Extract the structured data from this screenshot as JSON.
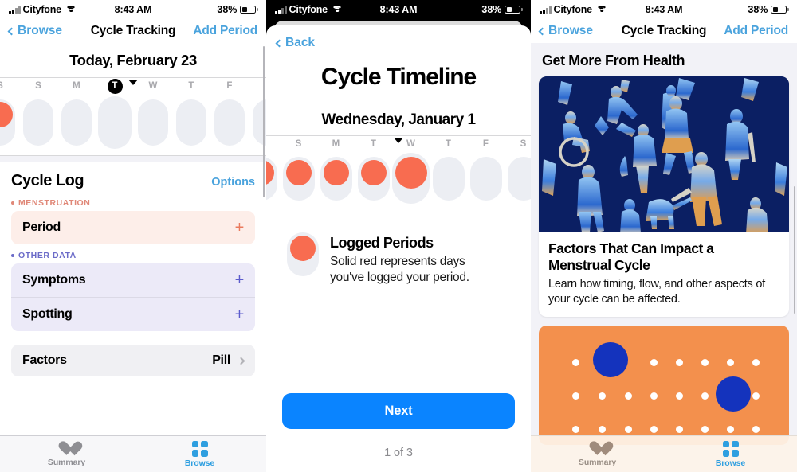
{
  "status_bar": {
    "carrier": "Cityfone",
    "time": "8:43 AM",
    "battery": "38%"
  },
  "colors": {
    "accent_blue": "#4aa3dd",
    "button_blue": "#0a84ff",
    "period_red": "#f86c50",
    "menstruation_label": "#e08878",
    "other_data_label": "#6b6bc8",
    "orange_card": "#f3904d",
    "artwork_navy": "#0b1f63",
    "blue_dot": "#1433bd"
  },
  "screen1": {
    "nav": {
      "back": "Browse",
      "title": "Cycle Tracking",
      "action": "Add Period"
    },
    "today_heading": "Today, February 23",
    "calendar": {
      "days": [
        {
          "letter": "S",
          "state": "period-partial",
          "today": false
        },
        {
          "letter": "S",
          "state": "empty",
          "today": false
        },
        {
          "letter": "M",
          "state": "empty",
          "today": false
        },
        {
          "letter": "T",
          "state": "selected",
          "today": true
        },
        {
          "letter": "W",
          "state": "empty",
          "today": false
        },
        {
          "letter": "T",
          "state": "empty",
          "today": false
        },
        {
          "letter": "F",
          "state": "empty",
          "today": false
        }
      ]
    },
    "cycle_log": {
      "title": "Cycle Log",
      "options_label": "Options",
      "groups": [
        {
          "label": "MENSTRUATION",
          "style": "mens",
          "rows": [
            {
              "label": "Period",
              "action": "+"
            }
          ]
        },
        {
          "label": "OTHER DATA",
          "style": "other",
          "rows": [
            {
              "label": "Symptoms",
              "action": "+"
            },
            {
              "label": "Spotting",
              "action": "+"
            }
          ]
        }
      ],
      "factors": {
        "label": "Factors",
        "value": "Pill"
      }
    },
    "tabbar": [
      {
        "label": "Summary",
        "icon": "heart-icon",
        "active": false
      },
      {
        "label": "Browse",
        "icon": "grid-icon",
        "active": true
      }
    ]
  },
  "screen2": {
    "back_label": "Back",
    "sheet_title": "Cycle Timeline",
    "date_heading": "Wednesday, January 1",
    "calendar": {
      "days": [
        {
          "letter": "",
          "state": "period-partial",
          "selected": false
        },
        {
          "letter": "S",
          "state": "period",
          "selected": false
        },
        {
          "letter": "M",
          "state": "period",
          "selected": false
        },
        {
          "letter": "T",
          "state": "period",
          "selected": false
        },
        {
          "letter": "W",
          "state": "period",
          "selected": true
        },
        {
          "letter": "T",
          "state": "empty",
          "selected": false
        },
        {
          "letter": "F",
          "state": "empty",
          "selected": false
        },
        {
          "letter": "S",
          "state": "empty",
          "selected": false
        }
      ]
    },
    "legend": {
      "heading": "Logged Periods",
      "body": "Solid red represents days you've logged your period."
    },
    "next_label": "Next",
    "page_indicator": "1 of 3"
  },
  "screen3": {
    "nav": {
      "back": "Browse",
      "title": "Cycle Tracking",
      "action": "Add Period"
    },
    "section_heading": "Get More From Health",
    "article": {
      "title": "Factors That Can Impact a Menstrual Cycle",
      "subtitle": "Learn how timing, flow, and other aspects of your cycle can be affected."
    },
    "tabbar": [
      {
        "label": "Summary",
        "icon": "heart-icon",
        "active": false
      },
      {
        "label": "Browse",
        "icon": "grid-icon",
        "active": true
      }
    ]
  }
}
